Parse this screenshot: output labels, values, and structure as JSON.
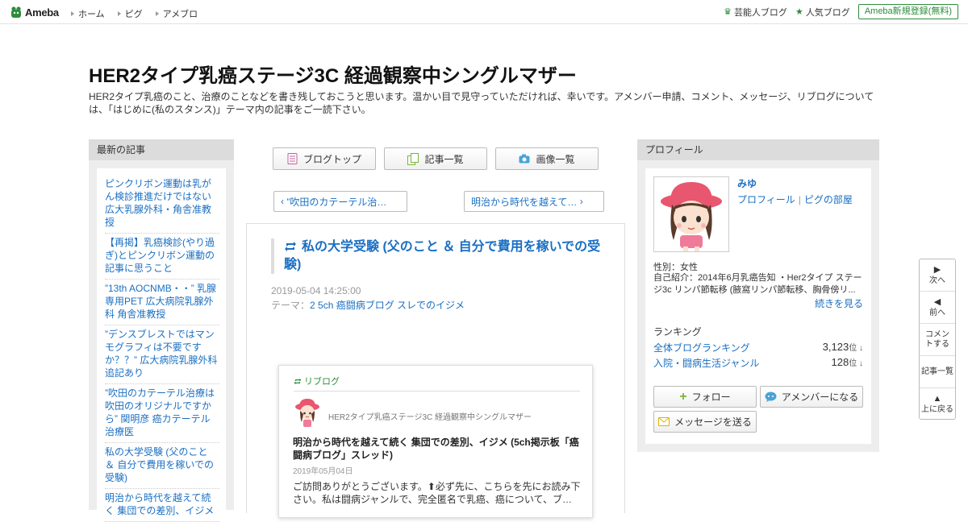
{
  "header": {
    "logo_text": "Ameba",
    "nav": [
      "ホーム",
      "ピグ",
      "アメブロ"
    ],
    "right_links": [
      {
        "label": "芸能人ブログ",
        "icon": "crown-icon"
      },
      {
        "label": "人気ブログ",
        "icon": "star-icon"
      }
    ],
    "register_label": "Ameba新規登録(無料)"
  },
  "blog": {
    "title": "HER2タイプ乳癌ステージ3C 経過観察中シングルマザー",
    "description": "HER2タイプ乳癌のこと、治療のことなどを書き残しておこうと思います。温かい目で見守っていただければ、幸いです。アメンバー申請、コメント、メッセージ、リブログについては、「はじめに(私のスタンス)」テーマ内の記事をご一読下さい。"
  },
  "left": {
    "heading": "最新の記事",
    "items": [
      "ピンクリボン運動は乳がん検診推進だけではない 広大乳腺外科・角舎准教授",
      "【再掲】乳癌検診(やり過ぎ)とピンクリボン運動の記事に思うこと",
      "”13th AOCNMB・・” 乳腺専用PET 広大病院乳腺外科 角舎准教授",
      "”デンスブレストではマンモグラフィは不要ですか？？” 広大病院乳腺外科 追記あり",
      "”吹田のカテーテル治療は吹田のオリジナルですから” 関明彦 癌カテーテル治療医",
      "私の大学受験 (父のこと ＆ 自分で費用を稼いでの受験)",
      "明治から時代を越えて続く 集団での差別、イジメ"
    ]
  },
  "center": {
    "buttons": [
      {
        "label": "ブログトップ",
        "icon": "document-icon"
      },
      {
        "label": "記事一覧",
        "icon": "list-icon"
      },
      {
        "label": "画像一覧",
        "icon": "camera-icon"
      }
    ],
    "prev_label": "”吹田のカテーテル治…",
    "next_label": "明治から時代を越えて…",
    "article": {
      "title": "私の大学受験 (父のこと ＆ 自分で費用を稼いでの受験)",
      "date": "2019-05-04 14:25:00",
      "theme_prefix": "テーマ：",
      "theme": "2 5ch 癌闘病ブログ スレでのイジメ"
    },
    "reblog": {
      "label": "リブログ",
      "blog_name": "HER2タイプ乳癌ステージ3C 経過観察中シングルマザー",
      "title": "明治から時代を越えて続く 集団での差別、イジメ (5ch掲示板「癌闘病ブログ」スレッド)",
      "date": "2019年05月04日",
      "body": "ご訪問ありがとうございます。⬆必ず先に、こちらを先にお読み下さい。私は闘病ジャンルで、完全匿名で乳癌、癌について、ブ…"
    }
  },
  "profile": {
    "heading": "プロフィール",
    "name": "みゆ",
    "link_profile": "プロフィール",
    "link_room": "ピグの部屋",
    "sex": "性別：女性",
    "intro": "自己紹介：2014年6月乳癌告知 ・Her2タイプ ステージ3c リンパ節転移 (腋窩リンパ節転移、胸骨傍リ...",
    "more": "続きを見る",
    "ranking_heading": "ランキング",
    "rankings": [
      {
        "label": "全体ブログランキング",
        "value": "3,123",
        "unit": "位 ↓"
      },
      {
        "label": "入院・闘病生活ジャンル",
        "value": "128",
        "unit": "位 ↓"
      }
    ],
    "follow_label": "フォロー",
    "amember_label": "アメンバーになる",
    "message_label": "メッセージを送る"
  },
  "sidemenu": [
    {
      "glyph": "▶",
      "label": "次へ"
    },
    {
      "glyph": "◀",
      "label": "前へ"
    },
    {
      "glyph": "",
      "label": "コメントする"
    },
    {
      "glyph": "",
      "label": "記事一覧"
    },
    {
      "glyph": "▲",
      "label": "上に戻る"
    }
  ],
  "colors": {
    "brand_green": "#2d8c3c",
    "link_blue": "#1a6fc2"
  }
}
